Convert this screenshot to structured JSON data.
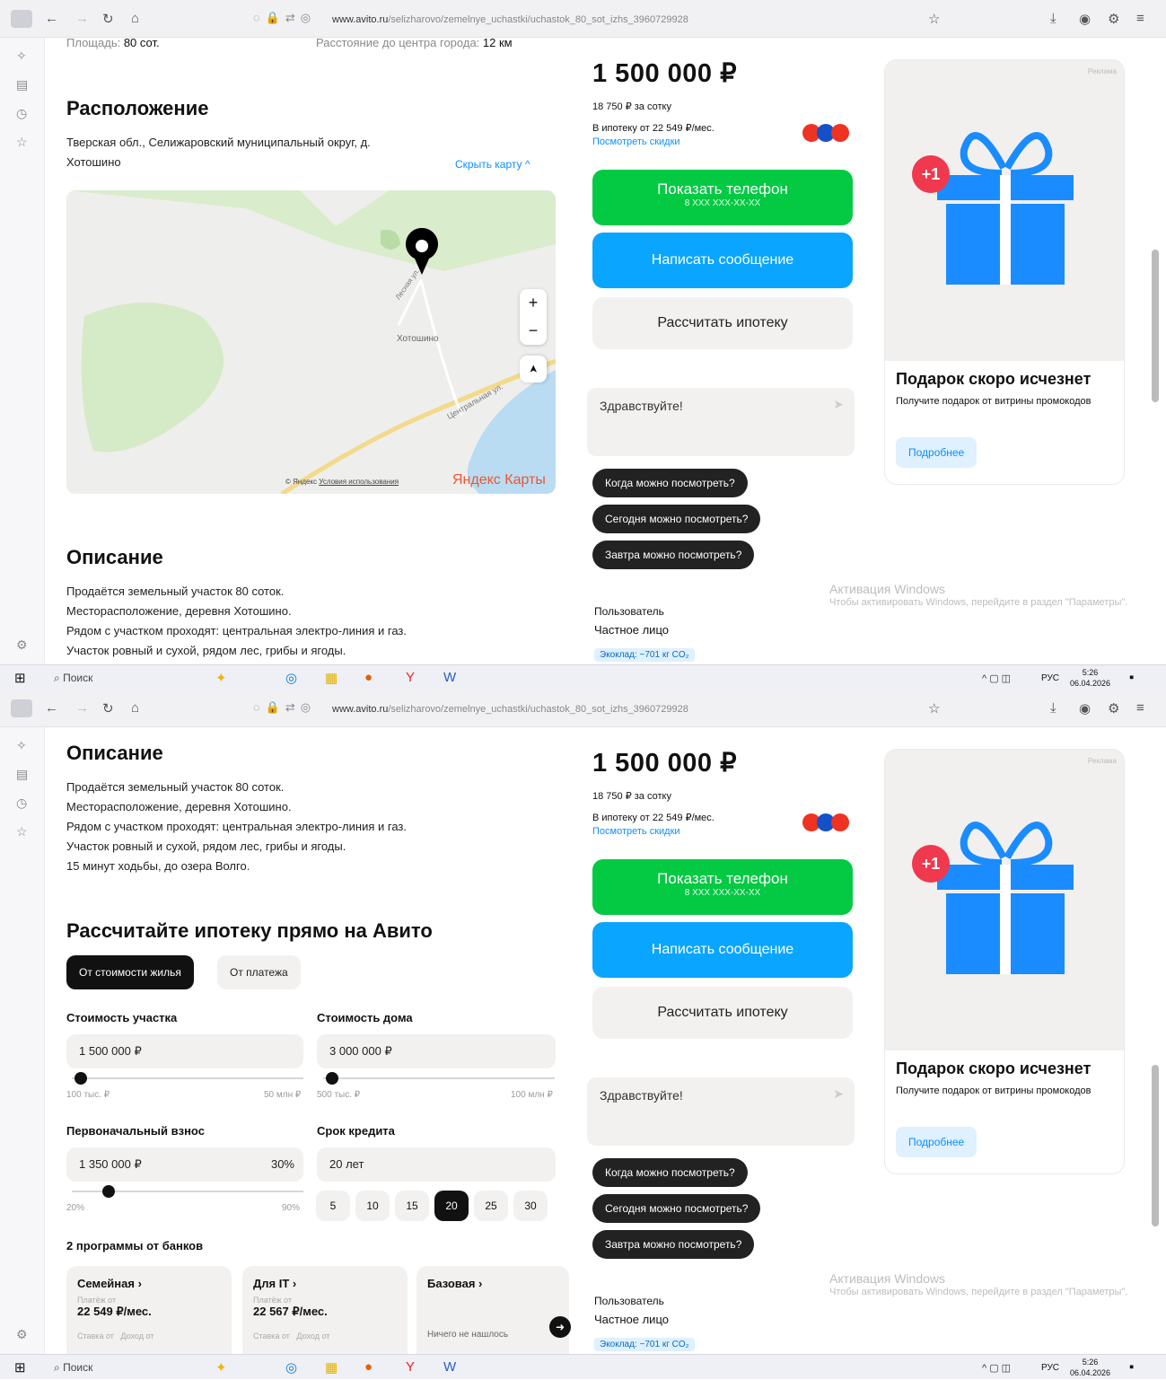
{
  "browser": {
    "url_host": "www.avito.ru",
    "url_path": "/selizharovo/zemelnye_uchastki/uchastok_80_sot_izhs_3960729928"
  },
  "colors": {
    "green": "#03c943",
    "blue": "#0aa5ff",
    "dark": "#222222",
    "gift": "#1a8cff",
    "badge": "#f0384e"
  },
  "top": {
    "area_label": "Площадь:",
    "area_value": "80 сот.",
    "distance_label": "Расстояние до центра города:",
    "distance_value": "12 км"
  },
  "location": {
    "title": "Расположение",
    "address": "Тверская обл., Селижаровский муниципальный округ, д. Хотошино",
    "hide_map": "Скрыть карту ^",
    "map_place": "Хотошино",
    "map_street": "Центральная ул.",
    "map_street2": "Лесная ул.",
    "map_copyright": "© Яндекс",
    "map_terms": "Условия использования",
    "map_brand": "Яндекс Карты",
    "zoom_in": "+",
    "zoom_out": "−",
    "locate": "➤"
  },
  "description": {
    "title": "Описание",
    "lines": [
      "Продаётся земельный участок 80 соток.",
      "Месторасположение, деревня Хотошино.",
      "Рядом с участком проходят: центральная электро-линия и газ.",
      "Участок ровный и сухой, рядом лес, грибы и ягоды.",
      "15 минут ходьбы, до озера Волго."
    ]
  },
  "sidebar": {
    "price": "1 500 000 ₽",
    "per_sotka": "18 750 ₽ за сотку",
    "mortgage": "В ипотеку от 22 549 ₽/мес.",
    "offers_link": "Посмотреть скидки",
    "show_phone": "Показать телефон",
    "phone_masked": "8 XXX XXX-XX-XX",
    "write_message": "Написать сообщение",
    "calc_mortgage": "Рассчитать ипотеку",
    "msg_text": "Здравствуйте!",
    "chips": [
      "Когда можно посмотреть?",
      "Сегодня можно посмотреть?",
      "Завтра можно посмотреть?"
    ],
    "seller_role": "Пользователь",
    "seller_type": "Частное лицо",
    "eco": "Экоклад: −701 кг CO₂"
  },
  "ad": {
    "corner": "Реклама",
    "badge": "+1",
    "title": "Подарок скоро исчезнет",
    "text": "Получите подарок от витрины промокодов",
    "button": "Подробнее"
  },
  "windows": {
    "title": "Активация Windows",
    "text": "Чтобы активировать Windows, перейдите в раздел \"Параметры\"."
  },
  "taskbar": {
    "search": "Поиск",
    "lang": "РУС",
    "time": "5:26",
    "date": "06.04.2026"
  },
  "calc": {
    "title": "Рассчитайте ипотеку прямо на Авито",
    "tab_active": "От стоимости жилья",
    "tab_other": "От платежа",
    "plot_label": "Стоимость участка",
    "plot_value": "1 500 000 ₽",
    "plot_min": "100 тыс. ₽",
    "plot_max": "50 млн ₽",
    "house_label": "Стоимость дома",
    "house_value": "3 000 000 ₽",
    "house_min": "500 тыс. ₽",
    "house_max": "100 млн ₽",
    "down_label": "Первоначальный взнос",
    "down_value": "1 350 000 ₽",
    "down_pct": "30%",
    "down_min": "20%",
    "down_max": "90%",
    "term_label": "Срок кредита",
    "term_value": "20 лет",
    "terms": [
      "5",
      "10",
      "15",
      "20",
      "25",
      "30"
    ],
    "term_selected": "20",
    "plot_slider": 0.04,
    "house_slider": 0.06,
    "down_slider": 0.16,
    "programs_title": "2 программы от банков",
    "programs": [
      {
        "name": "Семейная ›",
        "pay_label": "Платёж от",
        "pay": "22 549 ₽/мес.",
        "foot1": "Ставка от",
        "foot2": "Доход от"
      },
      {
        "name": "Для IT ›",
        "pay_label": "Платёж от",
        "pay": "22 567 ₽/мес.",
        "foot1": "Ставка от",
        "foot2": "Доход от"
      },
      {
        "name": "Базовая ›",
        "pay_label": "",
        "pay": "",
        "foot1": "Ничего не нашлось",
        "foot2": ""
      }
    ],
    "next": "➜"
  }
}
